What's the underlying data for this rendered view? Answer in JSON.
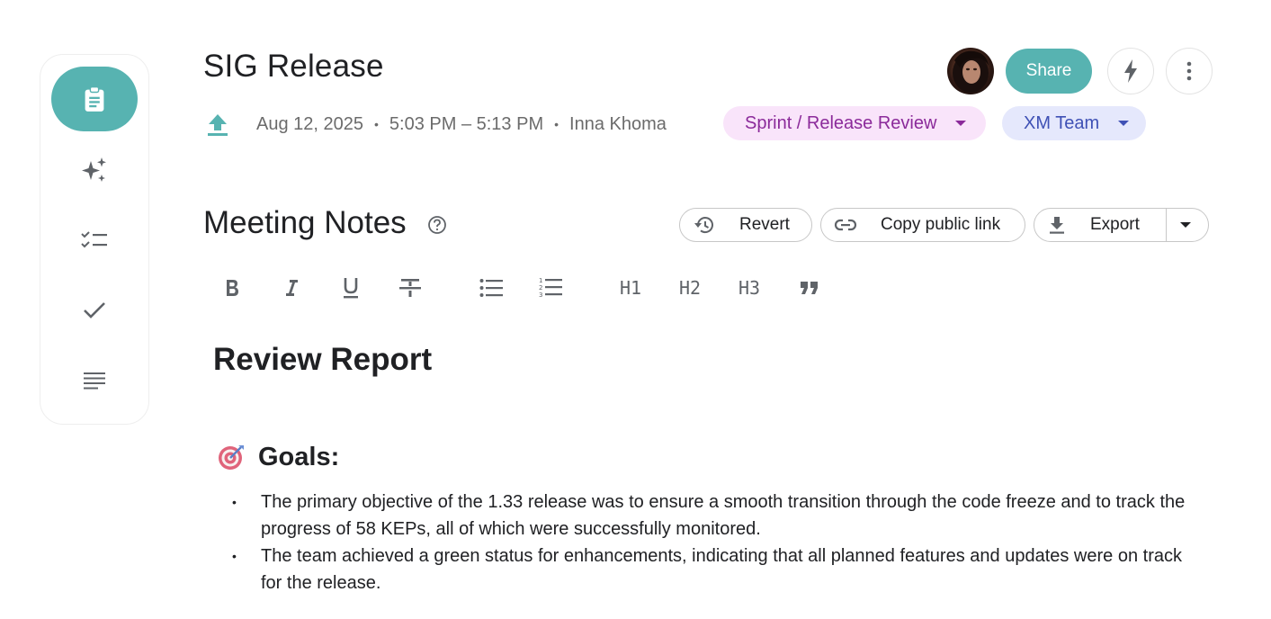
{
  "header": {
    "title": "SIG Release",
    "date": "Aug 12, 2025",
    "time": "5:03 PM – 5:13 PM",
    "author": "Inna Khoma",
    "separator": "•",
    "tags": [
      {
        "label": "Sprint / Release Review",
        "color": "#8b2a9a",
        "background": "#f9e4fa"
      },
      {
        "label": "XM Team",
        "color": "#3f51b5",
        "background": "#e5e8fc"
      }
    ],
    "share_label": "Share"
  },
  "sidebar": {
    "items": [
      {
        "icon": "clipboard-icon",
        "active": true
      },
      {
        "icon": "sparkles-icon",
        "active": false
      },
      {
        "icon": "checklist-icon",
        "active": false
      },
      {
        "icon": "check-icon",
        "active": false
      },
      {
        "icon": "notes-lines-icon",
        "active": false
      }
    ]
  },
  "notes": {
    "section_title": "Meeting Notes",
    "revert_label": "Revert",
    "copy_link_label": "Copy public link",
    "export_label": "Export"
  },
  "toolbar": {
    "h1": "H1",
    "h2": "H2",
    "h3": "H3"
  },
  "document": {
    "title": "Review Report",
    "goals_heading": "Goals:",
    "goals": [
      "The primary objective of the 1.33 release was to ensure a smooth transition through the code freeze and to track the progress of 58 KEPs, all of which were successfully monitored.",
      "The team achieved a green status for enhancements, indicating that all planned features and updates were on track for the release."
    ]
  },
  "colors": {
    "accent": "#57b3b1",
    "text": "#202124",
    "muted": "#6b6b6b"
  }
}
